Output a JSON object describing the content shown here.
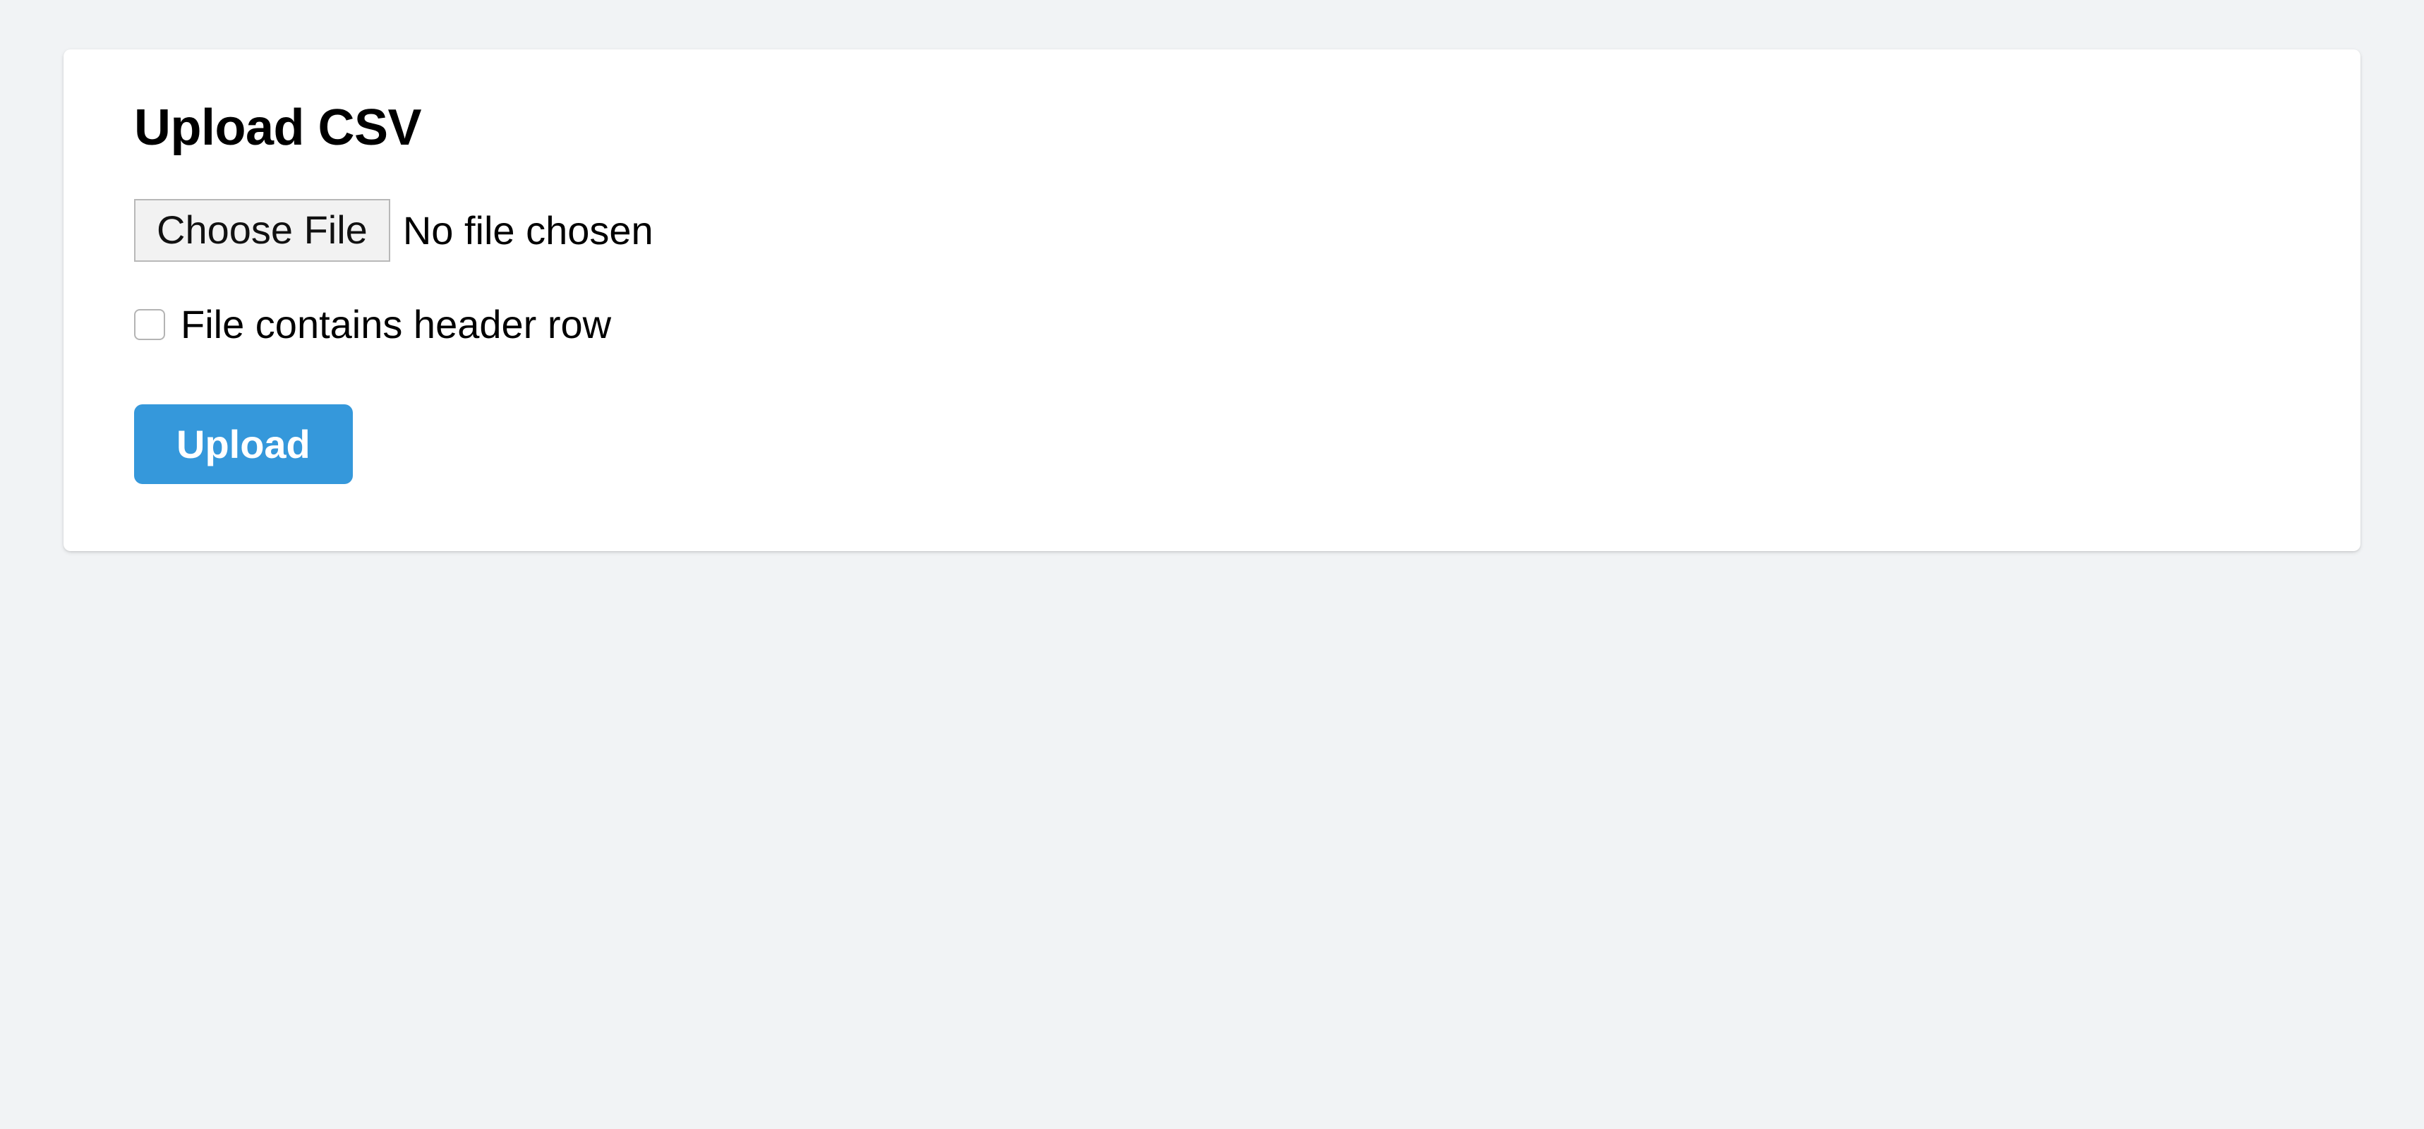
{
  "card": {
    "title": "Upload CSV",
    "file_input": {
      "button_label": "Choose File",
      "status_text": "No file chosen"
    },
    "header_checkbox": {
      "label": "File contains header row",
      "checked": false
    },
    "submit_label": "Upload"
  }
}
